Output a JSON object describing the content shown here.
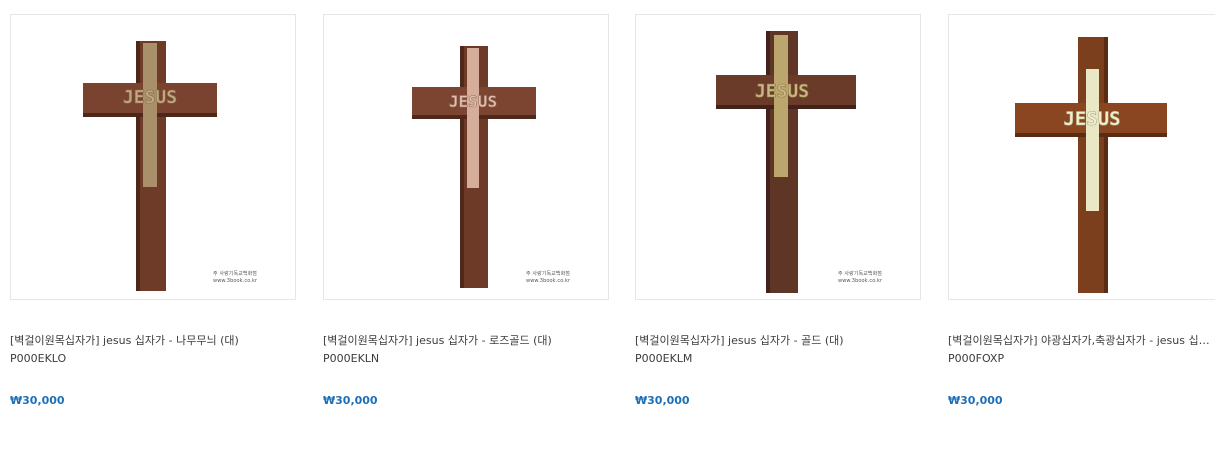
{
  "products": [
    {
      "name": "[벽걸이원목십자가] jesus 십자가 - 나무무늬 (대)",
      "code": "P000EKLO",
      "price": "₩30,000",
      "watermark_line1": "주 사랑기독교백화점",
      "watermark_line2": "www.3book.co.kr",
      "plate_color": "#a9906a",
      "wood_color": "#6e3b28",
      "icon": "wooden-cross-image"
    },
    {
      "name": "[벽걸이원목십자가] jesus 십자가 - 로즈골드 (대)",
      "code": "P000EKLN",
      "price": "₩30,000",
      "watermark_line1": "주 사랑기독교백화점",
      "watermark_line2": "www.3book.co.kr",
      "plate_color": "#d6ad9a",
      "wood_color": "#6e3b28",
      "icon": "wooden-cross-image"
    },
    {
      "name": "[벽걸이원목십자가] jesus 십자가 - 골드 (대)",
      "code": "P000EKLM",
      "price": "₩30,000",
      "watermark_line1": "주 사랑기독교백화점",
      "watermark_line2": "www.3book.co.kr",
      "plate_color": "#bba66e",
      "wood_color": "#5f3526",
      "icon": "wooden-cross-image"
    },
    {
      "name": "[벽걸이원목십자가] 야광십자가,축광십자가 - jesus 십자가 (대)",
      "code": "P000FOXP",
      "price": "₩30,000",
      "plate_color": "#e9e7c4",
      "wood_color": "#7c3f1e",
      "icon": "wooden-cross-image"
    }
  ]
}
